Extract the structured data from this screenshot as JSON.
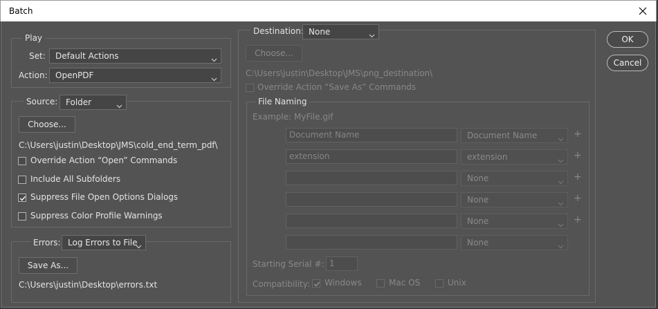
{
  "window": {
    "title": "Batch"
  },
  "play": {
    "legend": "Play",
    "set_label": "Set:",
    "set_value": "Default Actions",
    "action_label": "Action:",
    "action_value": "OpenPDF"
  },
  "source": {
    "label": "Source:",
    "value": "Folder",
    "choose_button": "Choose...",
    "path": "C:\\Users\\justin\\Desktop\\JMS\\cold_end_term_pdf\\",
    "checkboxes": [
      {
        "label": "Override Action “Open” Commands",
        "checked": false
      },
      {
        "label": "Include All Subfolders",
        "checked": false
      },
      {
        "label": "Suppress File Open Options Dialogs",
        "checked": true
      },
      {
        "label": "Suppress Color Profile Warnings",
        "checked": false
      }
    ]
  },
  "errors": {
    "label": "Errors:",
    "value": "Log Errors to File",
    "save_button": "Save As...",
    "path": "C:\\Users\\justin\\Desktop\\errors.txt"
  },
  "destination": {
    "label": "Destination:",
    "value": "None",
    "choose_button": "Choose...",
    "path": "C:\\Users\\justin\\Desktop\\JMS\\png_destination\\",
    "override_label": "Override Action “Save As” Commands"
  },
  "file_naming": {
    "legend": "File Naming",
    "example": "Example: MyFile.gif",
    "rows": [
      {
        "text": "Document Name",
        "select": "Document Name",
        "plus": true
      },
      {
        "text": "extension",
        "select": "extension",
        "plus": true
      },
      {
        "text": "",
        "select": "None",
        "plus": true
      },
      {
        "text": "",
        "select": "None",
        "plus": true
      },
      {
        "text": "",
        "select": "None",
        "plus": true
      },
      {
        "text": "",
        "select": "None",
        "plus": false
      }
    ],
    "plus_symbol": "+",
    "serial_label": "Starting Serial #:",
    "serial_value": "1",
    "compat_label": "Compatibility:",
    "compat_windows": "Windows",
    "compat_mac": "Mac OS",
    "compat_unix": "Unix"
  },
  "buttons": {
    "ok": "OK",
    "cancel": "Cancel"
  }
}
